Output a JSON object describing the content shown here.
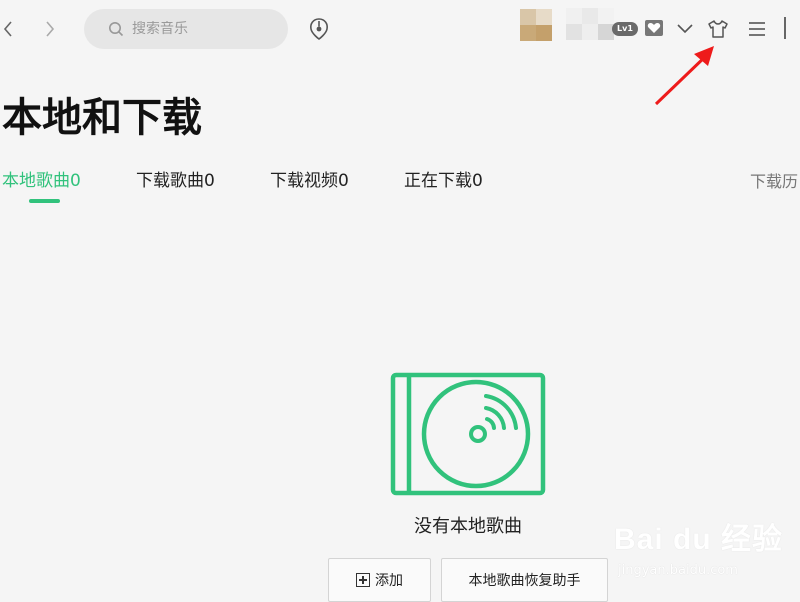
{
  "topbar": {
    "search_placeholder": "搜索音乐",
    "level_badge": "Lv1"
  },
  "page": {
    "title": "本地和下载"
  },
  "tabs": [
    {
      "label": "本地歌曲0",
      "active": true
    },
    {
      "label": "下载歌曲0",
      "active": false
    },
    {
      "label": "下载视频0",
      "active": false
    },
    {
      "label": "正在下载0",
      "active": false
    }
  ],
  "history_link": "下载历",
  "empty_state": {
    "message": "没有本地歌曲",
    "add_button": "添加",
    "restore_button": "本地歌曲恢复助手"
  },
  "watermark": {
    "logo_text": "Bai du 经验",
    "url": "jingyan.baidu.com"
  },
  "colors": {
    "accent": "#31c27c",
    "annotation_arrow": "#ee1b1b",
    "background": "#f5f5f5"
  },
  "icons": {
    "back": "chevron-left-icon",
    "forward": "chevron-right-icon",
    "search": "search-icon",
    "gene": "music-gene-icon",
    "vip": "vip-heart-icon",
    "dropdown": "chevron-down-icon",
    "skin": "tshirt-icon",
    "menu": "menu-icon",
    "empty": "cd-disc-icon"
  }
}
